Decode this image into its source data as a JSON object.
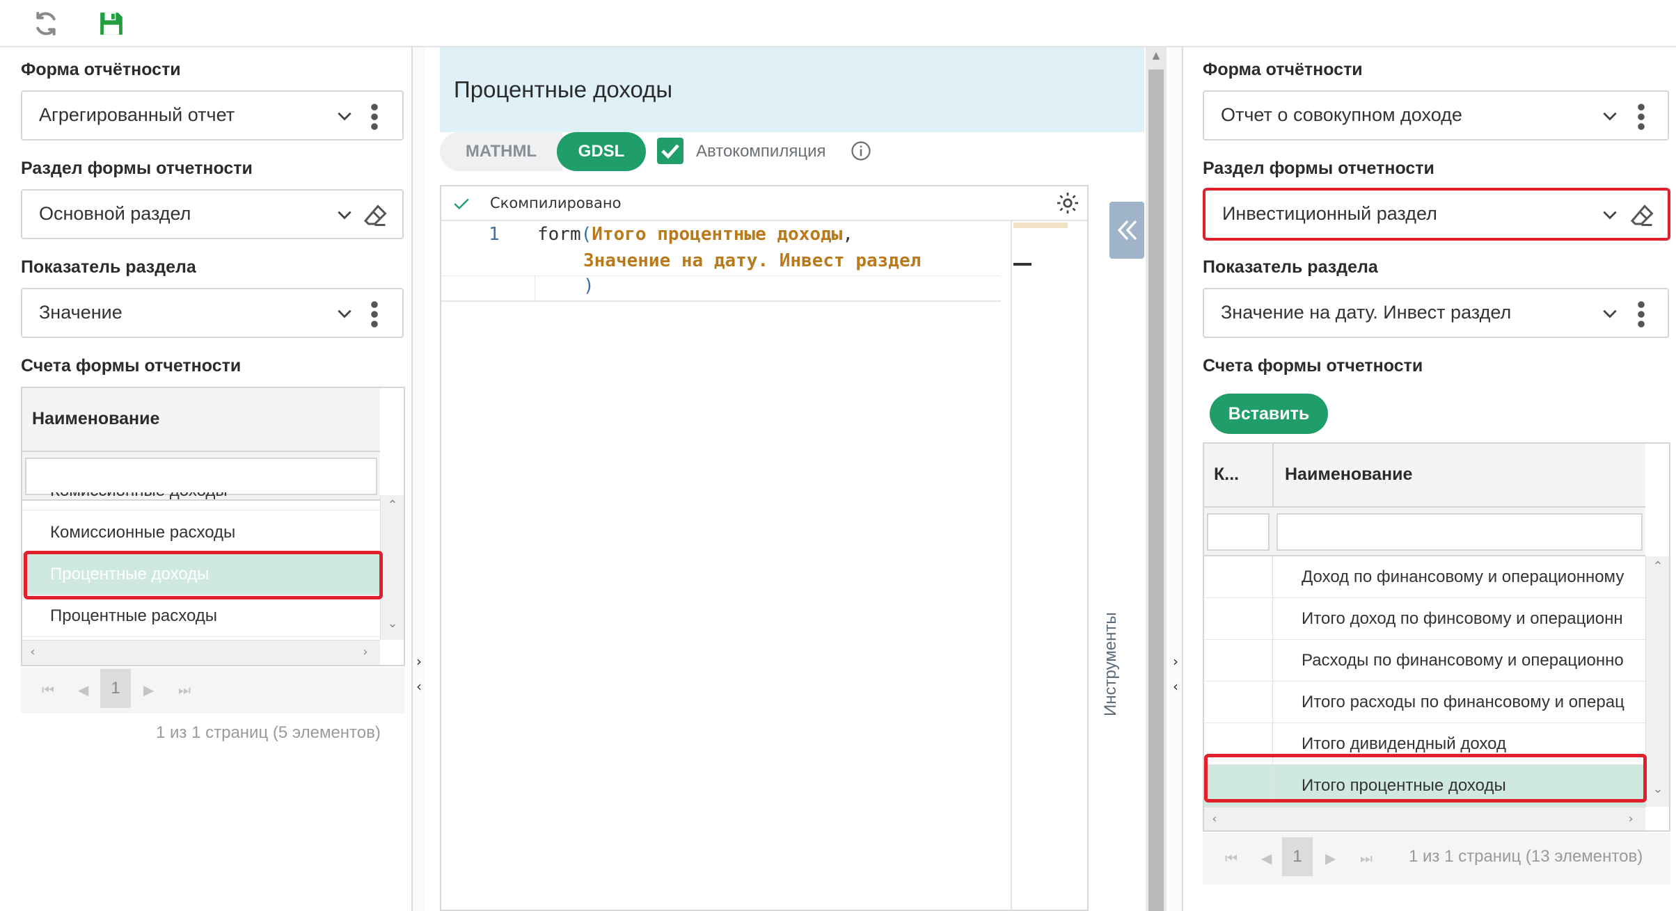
{
  "toolbar": {
    "refresh_icon": "refresh-icon",
    "save_icon": "save-icon",
    "accent": "#1f9e6a"
  },
  "left": {
    "form_label": "Форма отчётности",
    "form_value": "Агрегированный отчет",
    "section_label": "Раздел формы отчетности",
    "section_value": "Основной раздел",
    "indicator_label": "Показатель раздела",
    "indicator_value": "Значение",
    "accounts_label": "Счета формы отчетности",
    "grid_header": "Наименование",
    "rows": [
      "Комиссионные доходы",
      "Комиссионные расходы",
      "Процентные доходы",
      "Процентные расходы"
    ],
    "selected_index": 2,
    "page_current": "1",
    "page_info": "1 из 1 страниц (5 элементов)"
  },
  "center": {
    "title": "Процентные доходы",
    "tab_mathml": "MATHML",
    "tab_gdsl": "GDSL",
    "autocompile_label": "Автокомпиляция",
    "status_text": "Скомпилировано",
    "line_number": "1",
    "code_func": "form",
    "code_arg1": "Итого процентные доходы",
    "code_arg2": "Значение на дату. Инвест раздел",
    "tools_label": "Инструменты"
  },
  "right": {
    "form_label": "Форма отчётности",
    "form_value": "Отчет о совокупном доходе",
    "section_label": "Раздел формы отчетности",
    "section_value": "Инвестиционный раздел",
    "indicator_label": "Показатель раздела",
    "indicator_value": "Значение на дату. Инвест раздел",
    "accounts_label": "Счета формы отчетности",
    "insert_label": "Вставить",
    "col_code": "К...",
    "col_name": "Наименование",
    "rows": [
      "Доход по финансовому и операционному",
      "Итого доход по финсовому и операционн",
      "Расходы по финансовому и операционно",
      "Итого расходы по финансовому и операц",
      "Итого дивидендный доход",
      "Итого процентные доходы"
    ],
    "page_current": "1",
    "page_info": "1 из 1 страниц (13 элементов)"
  }
}
